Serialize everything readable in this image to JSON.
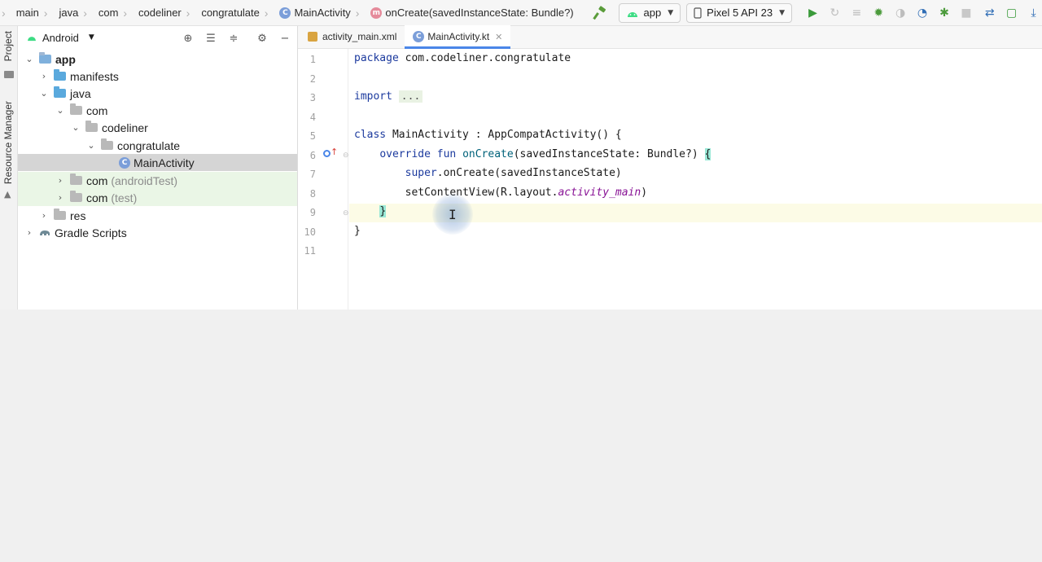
{
  "breadcrumbs": [
    "main",
    "java",
    "com",
    "codeliner",
    "congratulate",
    "MainActivity",
    "onCreate(savedInstanceState: Bundle?)"
  ],
  "toolbar": {
    "module_selector": "app",
    "device_selector": "Pixel 5 API 23"
  },
  "side_tabs": [
    "Project",
    "Resource Manager"
  ],
  "project": {
    "view_selector": "Android",
    "tree": [
      {
        "label": "app",
        "depth": 0,
        "expanded": true,
        "kind": "module"
      },
      {
        "label": "manifests",
        "depth": 1,
        "expanded": false,
        "kind": "folder"
      },
      {
        "label": "java",
        "depth": 1,
        "expanded": true,
        "kind": "folder"
      },
      {
        "label": "com",
        "depth": 2,
        "expanded": true,
        "kind": "package"
      },
      {
        "label": "codeliner",
        "depth": 3,
        "expanded": true,
        "kind": "package"
      },
      {
        "label": "congratulate",
        "depth": 4,
        "expanded": true,
        "kind": "package"
      },
      {
        "label": "MainActivity",
        "depth": 5,
        "kind": "class",
        "selected": true
      },
      {
        "label": "com",
        "suffix": "(androidTest)",
        "depth": 2,
        "expanded": false,
        "kind": "package",
        "highlight": true
      },
      {
        "label": "com",
        "suffix": "(test)",
        "depth": 2,
        "expanded": false,
        "kind": "package",
        "highlight": true
      },
      {
        "label": "res",
        "depth": 1,
        "expanded": false,
        "kind": "folder"
      },
      {
        "label": "Gradle Scripts",
        "depth": 0,
        "expanded": false,
        "kind": "gradle"
      }
    ]
  },
  "editor": {
    "tabs": [
      {
        "label": "activity_main.xml",
        "active": false
      },
      {
        "label": "MainActivity.kt",
        "active": true
      }
    ],
    "line_numbers": [
      "1",
      "2",
      "3",
      "4",
      "5",
      "6",
      "7",
      "8",
      "9",
      "10",
      "11"
    ],
    "code": {
      "l1_kw": "package",
      "l1_rest": " com.codeliner.congratulate",
      "l3_kw": "import",
      "l3_fold": "...",
      "l6_kw": "class",
      "l6_rest": " MainActivity : AppCompatActivity() {",
      "l7_kw": "override fun",
      "l7_fn": "onCreate",
      "l7_rest": "(savedInstanceState: Bundle?) ",
      "l7_brace": "{",
      "l8_kw": "super",
      "l8_rest": ".onCreate(savedInstanceState)",
      "l9_pre": "setContentView(R.layout.",
      "l9_it": "activity_main",
      "l9_post": ")",
      "l10_brace": "}",
      "l11_brace": "}"
    }
  },
  "colors": {
    "keyword": "#1c3a9e",
    "function": "#00627a",
    "resource": "#871094",
    "selection": "#d5d5d5",
    "test_highlight": "#eaf6e6",
    "active_tab_underline": "#4a86e8",
    "run_green": "#3a9a3a"
  }
}
